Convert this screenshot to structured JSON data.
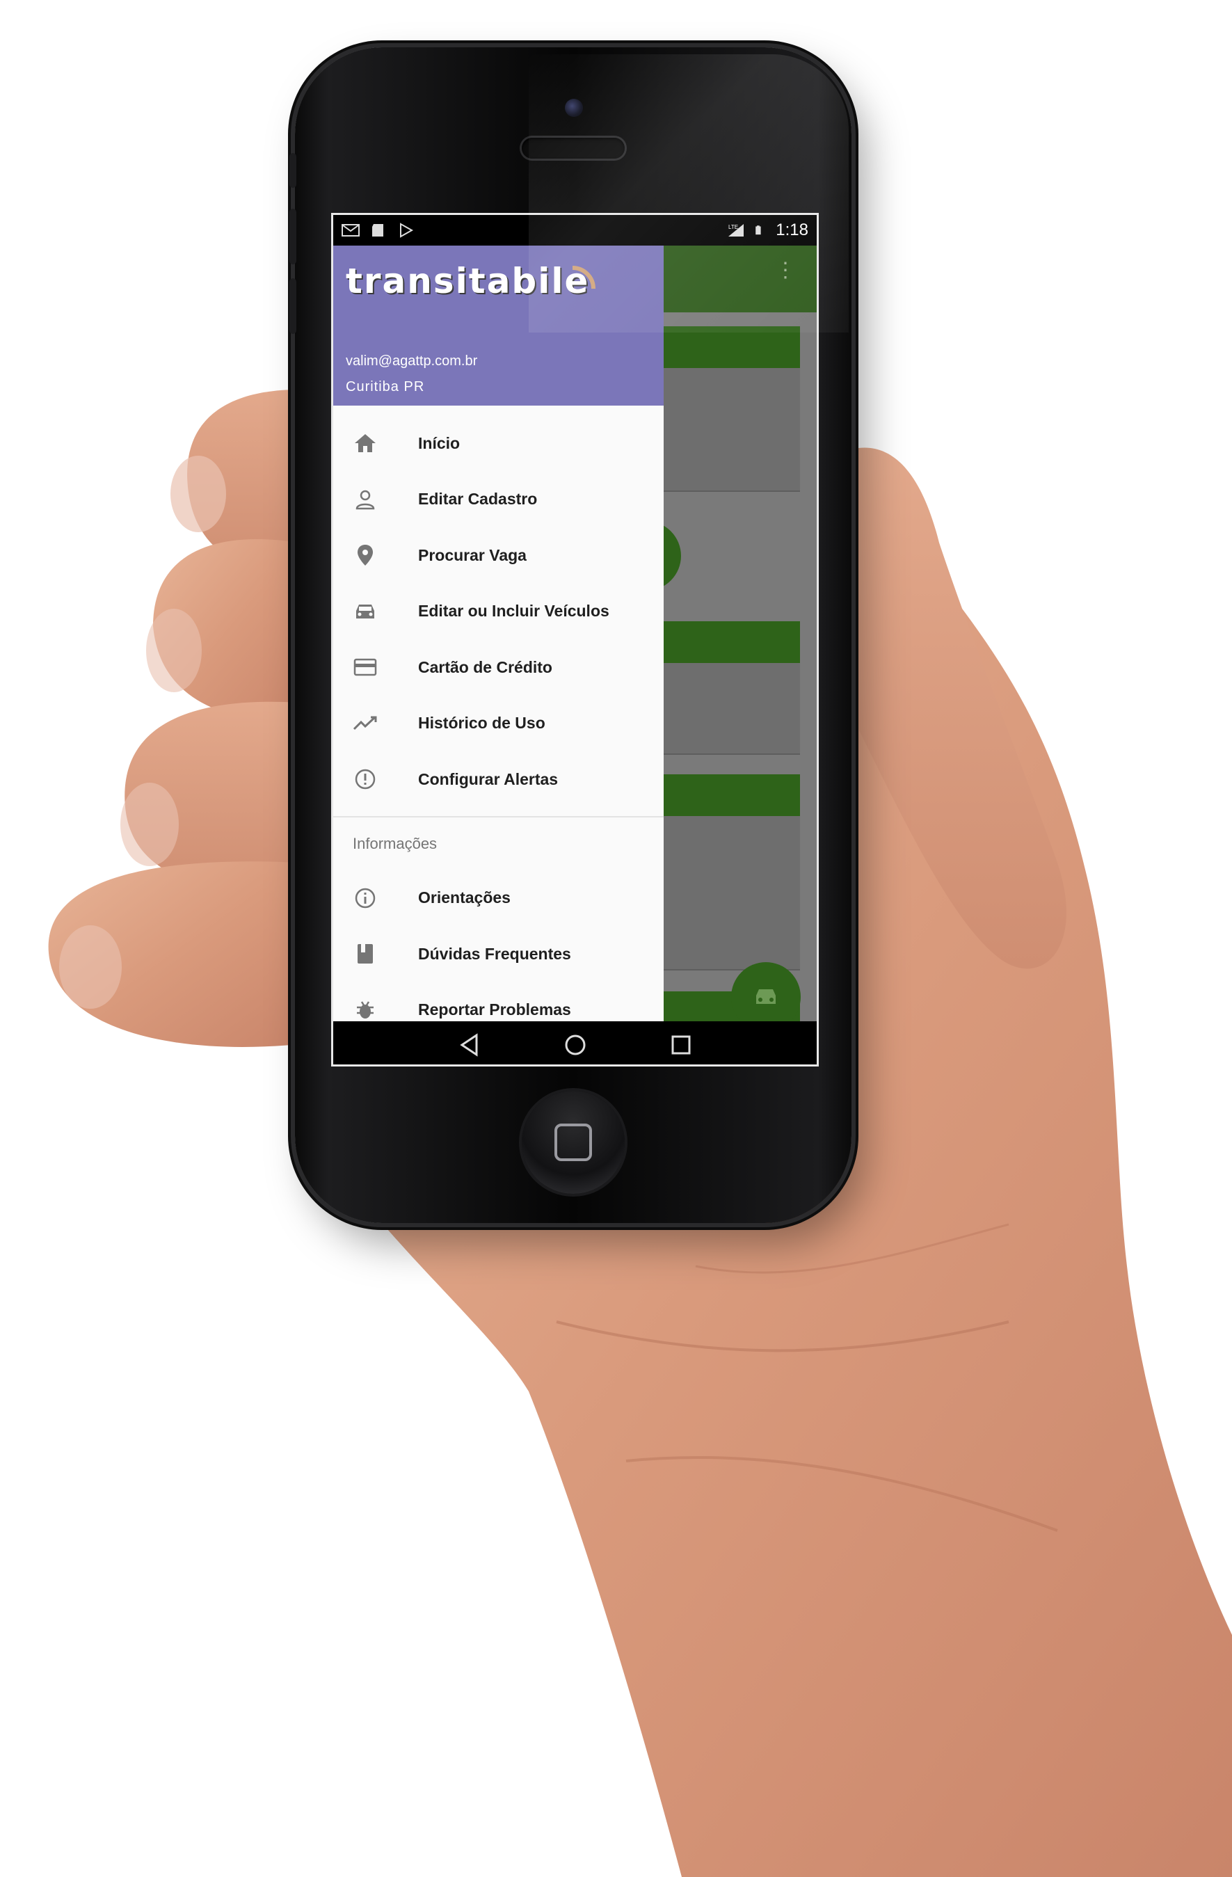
{
  "statusbar": {
    "icons_left": [
      "gmail-icon",
      "sd-card-icon",
      "play-store-icon"
    ],
    "network": "LTE",
    "time": "1:18"
  },
  "drawer": {
    "logo_text": "transitabile",
    "user_email": "valim@agattp.com.br",
    "user_city": "Curitiba PR",
    "menu_items": [
      {
        "label": "Início",
        "icon": "home-icon"
      },
      {
        "label": "Editar Cadastro",
        "icon": "person-icon"
      },
      {
        "label": "Procurar Vaga",
        "icon": "location-pin-icon"
      },
      {
        "label": "Editar ou Incluir Veículos",
        "icon": "car-icon"
      },
      {
        "label": "Cartão de Crédito",
        "icon": "credit-card-icon"
      },
      {
        "label": "Histórico de Uso",
        "icon": "trending-icon"
      },
      {
        "label": "Configurar Alertas",
        "icon": "alert-icon"
      }
    ],
    "section_title": "Informações",
    "info_items": [
      {
        "label": "Orientações",
        "icon": "info-icon"
      },
      {
        "label": "Dúvidas Frequentes",
        "icon": "book-icon"
      },
      {
        "label": "Reportar Problemas",
        "icon": "bug-icon"
      }
    ]
  },
  "colors": {
    "drawer_header": "#7b76b9",
    "app_green": "#2e6319",
    "background": "#ffffff"
  }
}
